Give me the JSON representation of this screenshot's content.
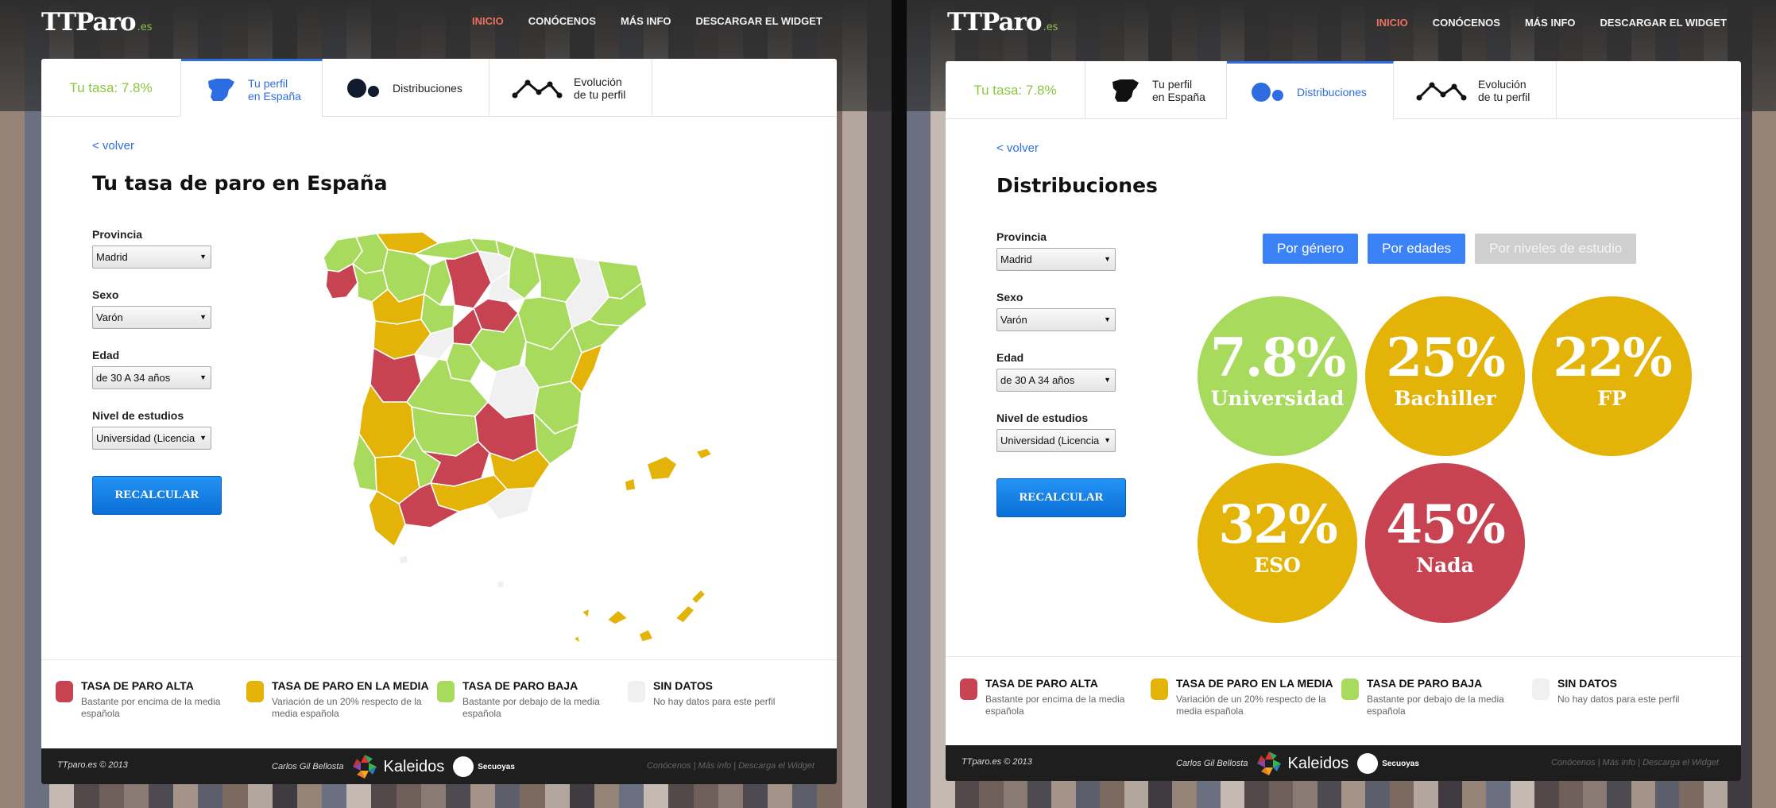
{
  "colors": {
    "high": "#c74352",
    "average": "#e3b407",
    "low": "#a7da5d",
    "no_data": "#f0f0f0",
    "accent": "#2e6de1",
    "nav_active": "#ec7160"
  },
  "site": {
    "logo_main": "TTParo",
    "logo_tld": ".es",
    "nav": [
      "INICIO",
      "CONÓCENOS",
      "MÁS INFO",
      "DESCARGAR EL WIDGET"
    ]
  },
  "tabs": {
    "rate": "Tu tasa: 7.8%",
    "perfil": "Tu perfil\nen España",
    "dist": "Distribuciones",
    "evol": "Evolución\nde tu perfil",
    "icons": [
      "spain-map-icon",
      "distribution-icon",
      "evolution-icon"
    ]
  },
  "form": {
    "back": "< volver",
    "provincia_label": "Provincia",
    "provincia_value": "Madrid",
    "sexo_label": "Sexo",
    "sexo_value": "Varón",
    "edad_label": "Edad",
    "edad_value": "de 30 A 34 años",
    "estudios_label": "Nivel de estudios",
    "estudios_value": "Universidad (Licencia",
    "recalc": "RECALCULAR"
  },
  "left": {
    "title": "Tu tasa de paro en España"
  },
  "right": {
    "title": "Distribuciones",
    "filters": [
      "Por género",
      "Por edades",
      "Por niveles de estudio"
    ],
    "bubbles": [
      {
        "value": "7.8%",
        "label": "Universidad",
        "level": "low"
      },
      {
        "value": "25%",
        "label": "Bachiller",
        "level": "average"
      },
      {
        "value": "22%",
        "label": "FP",
        "level": "average"
      },
      {
        "value": "32%",
        "label": "ESO",
        "level": "average"
      },
      {
        "value": "45%",
        "label": "Nada",
        "level": "high"
      }
    ]
  },
  "legend": [
    {
      "title": "TASA DE PARO ALTA",
      "desc": "Bastante por encima de la media española"
    },
    {
      "title": "TASA DE PARO EN LA MEDIA",
      "desc": "Variación de un 20% respecto de la media española"
    },
    {
      "title": "TASA DE PARO BAJA",
      "desc": "Bastante por debajo de la media española"
    },
    {
      "title": "SIN DATOS",
      "desc": "No hay datos para este perfil"
    }
  ],
  "footer": {
    "copy": "TTparo.es © 2013",
    "author": "Carlos Gil Bellosta",
    "brand1": "Kaleidos",
    "brand2": "Secuoyas",
    "links": "Conócenos | Más info | Descarga el Widget"
  }
}
